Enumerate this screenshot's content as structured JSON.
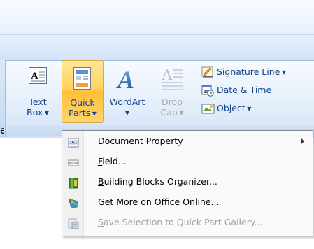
{
  "ribbon": {
    "text_box": {
      "line1": "Text",
      "line2": "Box"
    },
    "quick_parts": {
      "line1": "Quick",
      "line2": "Parts"
    },
    "wordart": {
      "line1": "WordArt"
    },
    "drop_cap": {
      "line1": "Drop",
      "line2": "Cap"
    },
    "signature_line": "Signature Line",
    "date_time": "Date & Time",
    "object": "Object",
    "stray_letter": "e"
  },
  "menu": {
    "items": [
      {
        "label": "Document Property",
        "icon": "document-property-icon",
        "has_submenu": true,
        "enabled": true
      },
      {
        "label": "Field...",
        "icon": "field-icon",
        "has_submenu": false,
        "enabled": true
      },
      {
        "label": "Building Blocks Organizer...",
        "icon": "building-blocks-icon",
        "has_submenu": false,
        "enabled": true
      },
      {
        "label": "Get More on Office Online...",
        "icon": "office-online-icon",
        "has_submenu": false,
        "enabled": true
      },
      {
        "label": "Save Selection to Quick Part Gallery...",
        "icon": "save-selection-icon",
        "has_submenu": false,
        "enabled": false
      }
    ]
  },
  "colors": {
    "ribbon_text": "#15428b",
    "active_button": "#ffd35f",
    "disabled_text": "#a0a0a0"
  }
}
